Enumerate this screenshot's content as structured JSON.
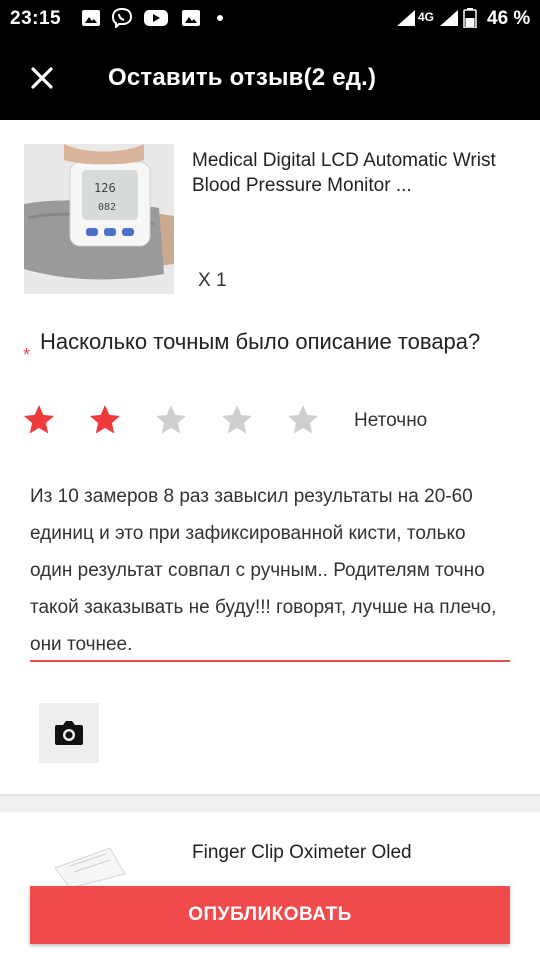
{
  "status_bar": {
    "time": "23:15",
    "network": "4G",
    "battery": "46 %",
    "icons": [
      "image-icon",
      "viber-icon",
      "youtube-icon",
      "image-icon",
      "notification-dot",
      "wifi-signal-icon",
      "cell-signal-icon",
      "battery-icon"
    ]
  },
  "appbar": {
    "title": "Оставить отзыв(2 ед.)",
    "close_icon": "close-icon"
  },
  "product1": {
    "title": "Medical Digital LCD Automatic Wrist Blood Pressure Monitor ...",
    "qty": "X 1"
  },
  "question": {
    "required_mark": "*",
    "text": "Насколько точным было описание товара?"
  },
  "rating": {
    "value": 2,
    "max": 5,
    "label": "Неточно"
  },
  "review": {
    "text": "Из 10 замеров 8 раз завысил результаты на 20-60 единиц и это при зафиксированной кисти, только один результат совпал с ручным.. Родителям точно такой заказывать не буду!!! говорят, лучше на плечо, они точнее."
  },
  "camera": {
    "icon": "camera-icon"
  },
  "product2": {
    "title": "Finger Clip Oximeter Oled"
  },
  "publish": {
    "label": "ОПУБЛИКОВАТЬ"
  },
  "colors": {
    "accent": "#f04a4a",
    "star_active": "#ee3a3a",
    "star_inactive": "#cfcfcf",
    "appbar_bg": "#000000"
  }
}
